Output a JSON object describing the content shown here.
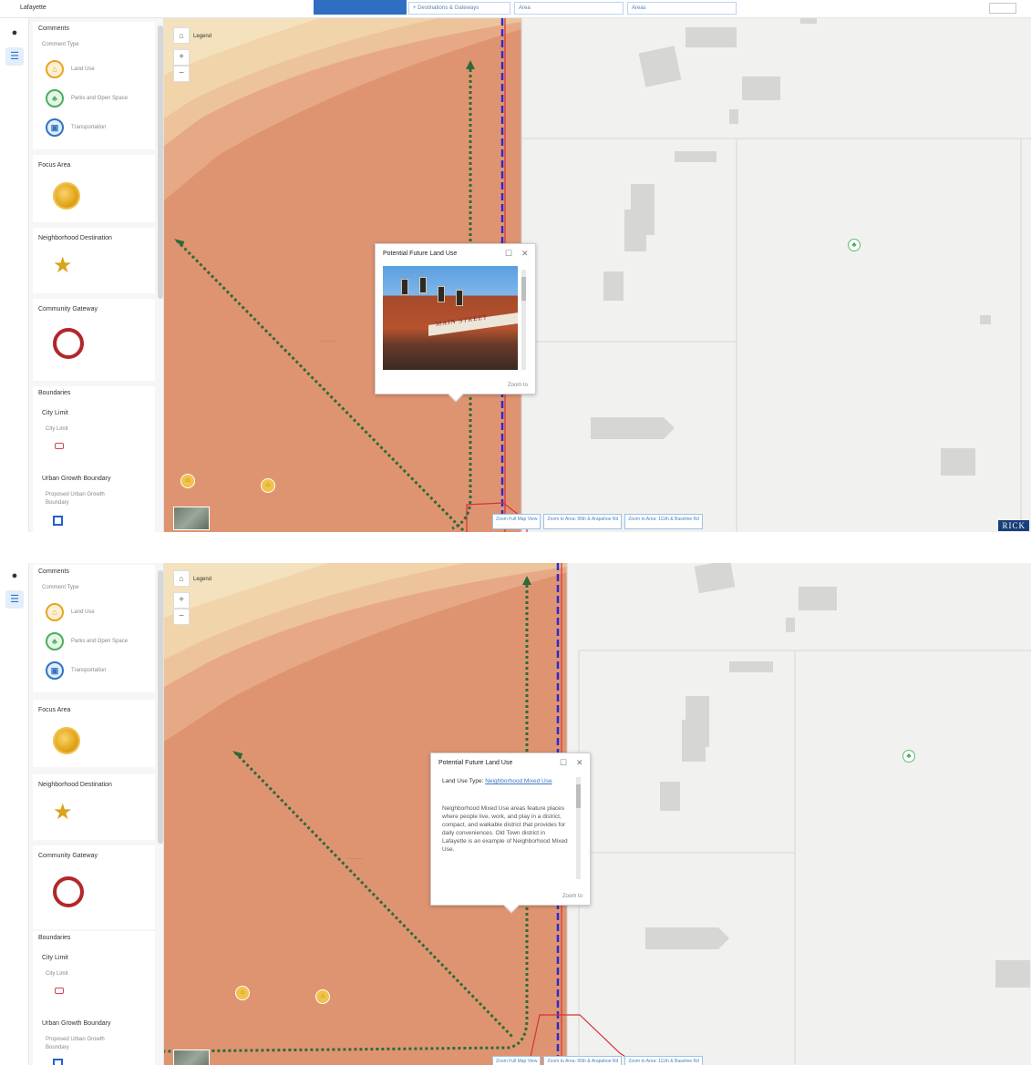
{
  "top": {
    "appbar": {
      "app_name": "Lafayette",
      "items": [
        "+ Destinations & Gateways",
        "Area",
        "Areas"
      ]
    }
  },
  "legend": {
    "comments": {
      "title": "Comments",
      "comment_type_label": "Comment Type",
      "items": [
        {
          "label": "Land Use",
          "icon": "home-icon",
          "color": "#e6a623"
        },
        {
          "label": "Parks and Open Space",
          "icon": "tree-icon",
          "color": "#4cae5a"
        },
        {
          "label": "Transportation",
          "icon": "bus-icon",
          "color": "#2f74c4"
        }
      ]
    },
    "focus_area": {
      "title": "Focus Area"
    },
    "neighborhood_destination": {
      "title": "Neighborhood Destination"
    },
    "community_gateway": {
      "title": "Community Gateway"
    },
    "boundaries": {
      "title": "Boundaries",
      "city_limit_title": "City Limit",
      "city_limit_label": "City Limit",
      "ugb_title": "Urban Growth Boundary",
      "ugb_label_line1": "Proposed Urban Growth",
      "ugb_label_line2": "Boundary"
    }
  },
  "map": {
    "basemap_label": "Legend",
    "zoom_in": "+",
    "zoom_out": "−",
    "home": "⌂",
    "zoom_buttons": [
      "Zoom Full Map View",
      "Zoom to Area: 95th & Arapahoe Rd",
      "Zoom to Area: 111th & Baseline Rd"
    ],
    "watermark": "RICK"
  },
  "popup": {
    "title": "Potential Future Land Use",
    "zoom_to": "Zoom to",
    "maximize": "☐",
    "close": "✕",
    "photo_sign": "MAIN STREET"
  },
  "popup2": {
    "title": "Potential Future Land Use",
    "field_label": "Land Use Type:",
    "field_value": "Neighborhood Mixed Use",
    "description": "Neighborhood Mixed Use areas feature places where people live, work, and play in a district, compact, and walkable district that provides for daily conveniences. Old Town district in Lafayette is an example of Neighborhood Mixed Use.",
    "zoom_to": "Zoom to"
  },
  "colors": {
    "land_use_orange": "#df9471",
    "basemap_gray": "#f1f1ef",
    "boundary_blue": "#2a2ad0",
    "arrow_green": "#2e6a3a",
    "city_limit_red": "#d6323a"
  }
}
